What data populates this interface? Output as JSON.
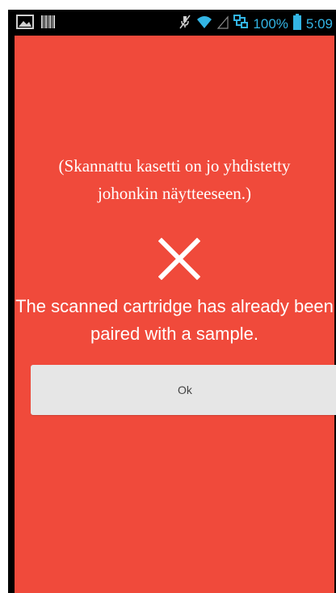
{
  "status_bar": {
    "battery_text": "100%",
    "time": "5:09",
    "left_icons": [
      "image-icon",
      "barcode-icon"
    ],
    "right_icons": [
      "mute-icon",
      "wifi-icon",
      "signal-icon",
      "sync-icon",
      "battery-icon"
    ]
  },
  "dialog": {
    "message_fi": "(Skannattu kasetti on jo yhdistetty johonkin näytteeseen.)",
    "icon": "close-icon",
    "message_en": "The scanned cartridge has already been paired with a sample.",
    "ok_label": "Ok"
  },
  "colors": {
    "background": "#f04a3b",
    "status_accent": "#33b5e5",
    "button_bg": "#e6e6e6"
  }
}
